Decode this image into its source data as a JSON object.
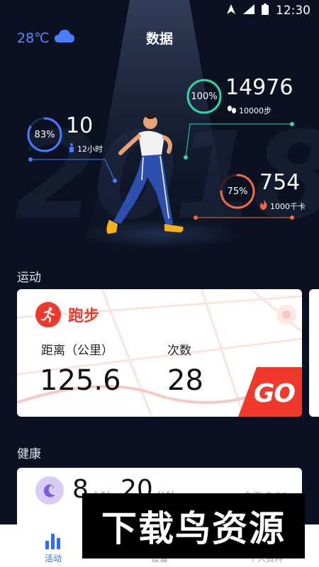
{
  "status_bar": {
    "time": "12:30"
  },
  "header": {
    "temperature": "28℃",
    "title": "数据"
  },
  "background_year": "2018",
  "stats": {
    "steps": {
      "percent": "100%",
      "value": "14976",
      "goal": "10000步",
      "color": "#2fd6a8",
      "fraction": 1.0
    },
    "stand": {
      "percent": "83%",
      "value": "10",
      "goal": "12小时",
      "color": "#4a7cff",
      "fraction": 0.83
    },
    "calories": {
      "percent": "75%",
      "value": "754",
      "goal": "1000千卡",
      "color": "#f06a42",
      "fraction": 0.75
    }
  },
  "sports_section": {
    "title": "运动",
    "card": {
      "activity": "跑步",
      "distance_label": "距离（公里）",
      "distance_value": "125.6",
      "count_label": "次数",
      "count_value": "28",
      "go_label": "GO"
    }
  },
  "health_section": {
    "title": "健康",
    "sleep": {
      "hours": "8",
      "minutes": "20",
      "hours_unit": "小时",
      "minutes_unit": "分钟",
      "date": "今天 7:30"
    }
  },
  "bottom_nav": [
    {
      "label": "活动",
      "active": true
    },
    {
      "label": "设备",
      "active": false
    },
    {
      "label": "个人资料",
      "active": false
    }
  ],
  "watermark": "下载鸟资源",
  "colors": {
    "accent": "#2f6bff",
    "run_red": "#f0382b",
    "background": "#0b1120"
  }
}
